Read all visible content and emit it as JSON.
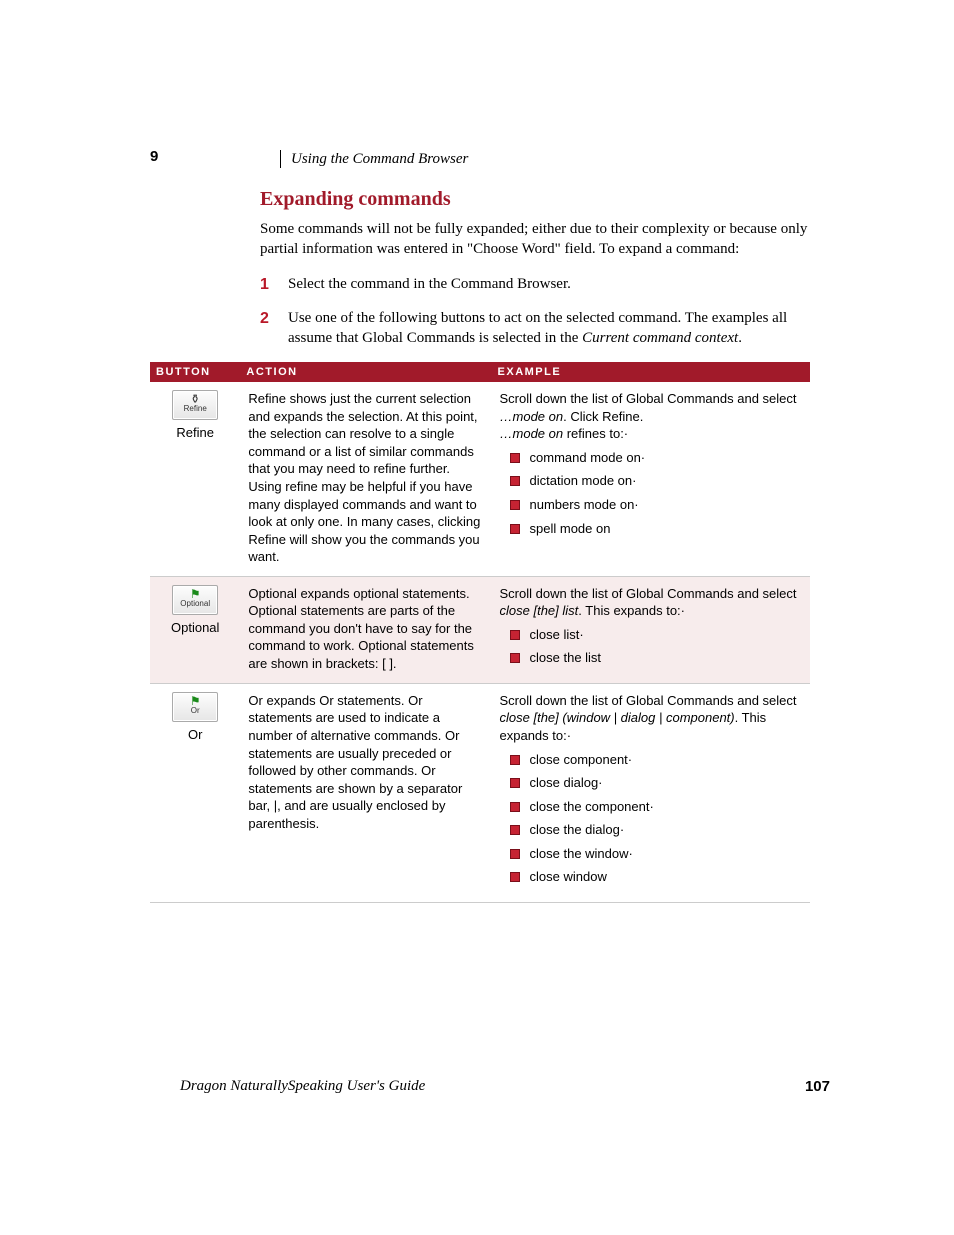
{
  "chapter_number": "9",
  "running_head": "Using the Command Browser",
  "section_title": "Expanding commands",
  "intro": "Some commands will not be fully expanded; either due to their complexity or because only partial information was entered in \"Choose Word\" field. To expand a command:",
  "steps": [
    {
      "num": "1",
      "text": "Select the command in the Command Browser."
    },
    {
      "num": "2",
      "text_prefix": "Use one of the following buttons to act on the selected command. The examples all assume that Global Commands is selected in the ",
      "text_italic": "Current command context",
      "text_suffix": "."
    }
  ],
  "table": {
    "headers": {
      "button": "BUTTON",
      "action": "ACTION",
      "example": "EXAMPLE"
    },
    "rows": [
      {
        "button_label": "Refine",
        "icon_text": "Refine",
        "action": "Refine shows just the current selection and expands the selection. At this point, the selection can resolve to a single command or a list of similar commands that you may need to refine further. Using refine may be helpful if you have many displayed commands and want to look at only one. In many cases, clicking Refine will show you the commands you want.",
        "example_lead": "Scroll down the list of Global Commands and select ",
        "example_cmd1": "…mode on",
        "example_lead2": ". Click Refine.",
        "example_line2_a": "…mode on",
        "example_line2_b": " refines to:·",
        "items": [
          "command mode on·",
          "dictation mode on·",
          "numbers mode on·",
          "spell mode on"
        ]
      },
      {
        "button_label": "Optional",
        "icon_text": "Optional",
        "action": "Optional expands optional statements. Optional statements are parts of the command you don't have to say for the command to work. Optional statements are shown in brackets: [ ].",
        "example_lead": "Scroll down the list of Global Commands and select ",
        "example_cmd1": "close [the] list",
        "example_lead2": ". This expands to:·",
        "items": [
          "close list·",
          "close the list"
        ]
      },
      {
        "button_label": "Or",
        "icon_text": "Or",
        "action": "Or expands Or statements. Or statements are used to indicate a number of alternative commands. Or statements are usually preceded or followed by other commands. Or statements are shown by a separator bar, |, and are usually enclosed by parenthesis.",
        "example_lead": "Scroll down the list of Global Commands and select ",
        "example_cmd1": "close [the] (window | dialog | component)",
        "example_lead2": ". This expands to:·",
        "items": [
          "close component·",
          "close dialog·",
          "close the component·",
          "close the dialog·",
          "close the window·",
          "close window"
        ]
      }
    ]
  },
  "footer_title": "Dragon NaturallySpeaking User's Guide",
  "page_number": "107"
}
